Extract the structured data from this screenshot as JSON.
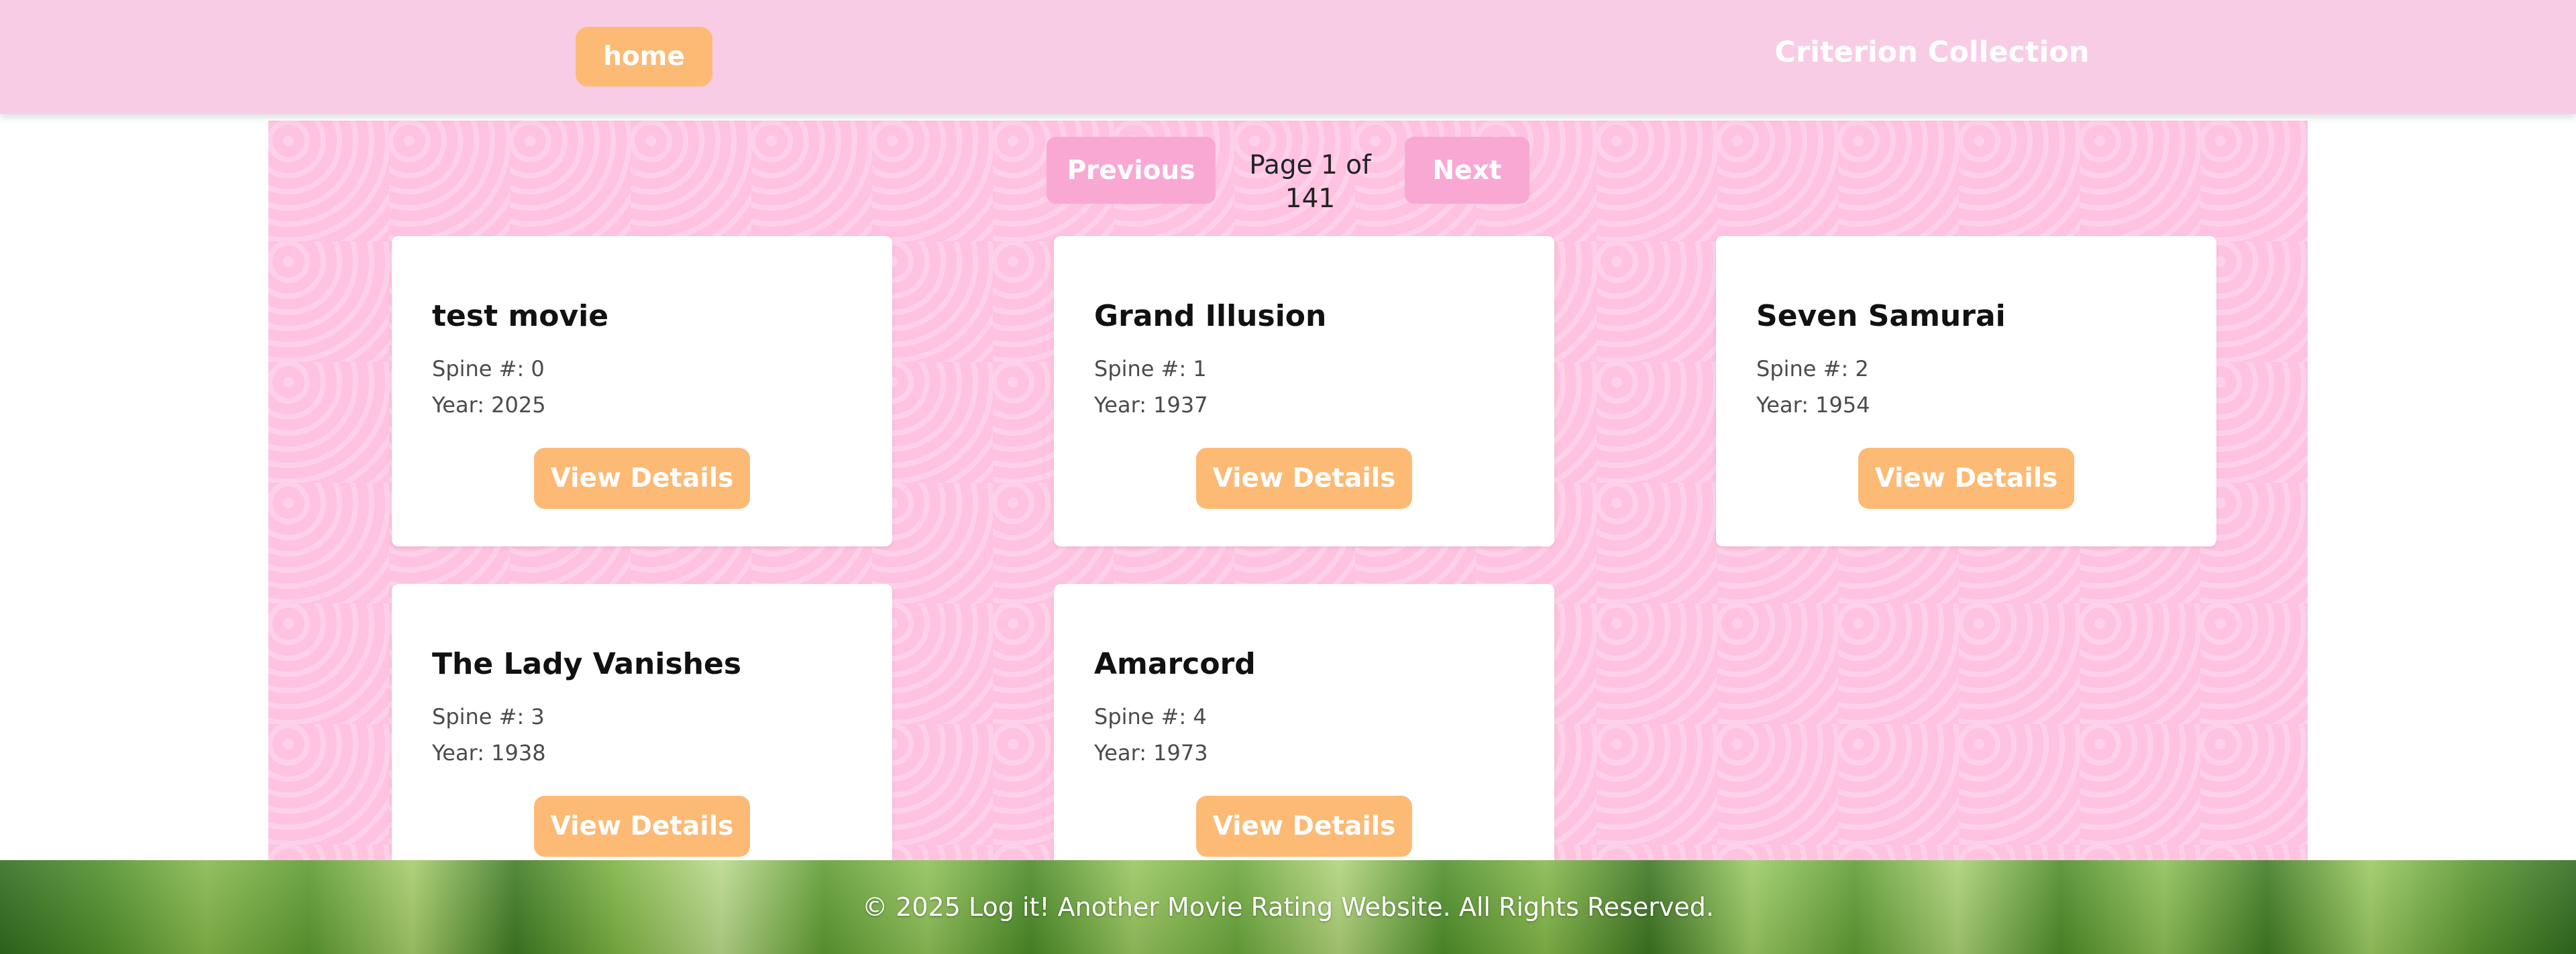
{
  "header": {
    "home_label": "home",
    "site_title": "Criterion Collection"
  },
  "pagination": {
    "previous_label": "Previous",
    "page_label": "Page 1 of 141",
    "next_label": "Next"
  },
  "movies": [
    {
      "title": "test movie",
      "spine": "Spine #: 0",
      "year": "Year: 2025",
      "button": "View Details"
    },
    {
      "title": "Grand Illusion",
      "spine": "Spine #: 1",
      "year": "Year: 1937",
      "button": "View Details"
    },
    {
      "title": "Seven Samurai",
      "spine": "Spine #: 2",
      "year": "Year: 1954",
      "button": "View Details"
    },
    {
      "title": "The Lady Vanishes",
      "spine": "Spine #: 3",
      "year": "Year: 1938",
      "button": "View Details"
    },
    {
      "title": "Amarcord",
      "spine": "Spine #: 4",
      "year": "Year: 1973",
      "button": "View Details"
    }
  ],
  "footer": {
    "copyright": "© 2025 Log it! Another Movie Rating Website. All Rights Reserved."
  },
  "colors": {
    "header_bg": "#f9cce5",
    "accent_orange": "#fdba74",
    "pagination_pink": "#f9a8d4",
    "panel_pink": "#ffc2e0"
  }
}
